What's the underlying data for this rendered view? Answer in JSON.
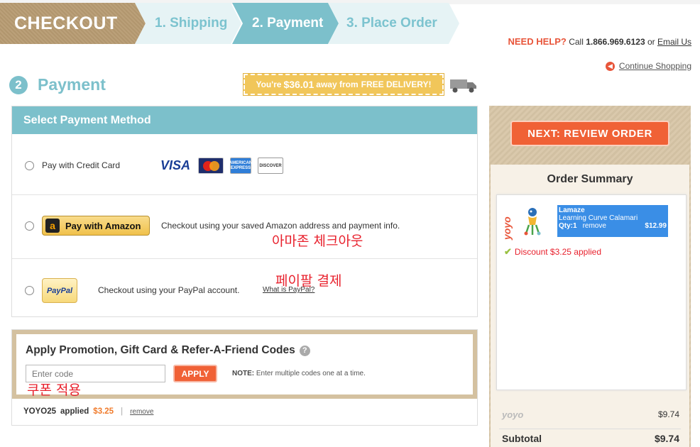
{
  "steps": {
    "checkout": "CHECKOUT",
    "shipping": "1. Shipping",
    "payment": "2. Payment",
    "place_order": "3. Place Order"
  },
  "help": {
    "need_help": "NEED HELP?",
    "call": "Call",
    "phone": "1.866.969.6123",
    "or": "or",
    "email": "Email Us"
  },
  "continue_shopping": "Continue Shopping",
  "payment": {
    "number": "2",
    "title": "Payment",
    "free_delivery": {
      "prefix": "You're",
      "amount": "$36.01",
      "middle": "away from",
      "suffix": "FREE DELIVERY!"
    }
  },
  "method": {
    "header": "Select Payment Method",
    "credit_card_label": "Pay with Credit Card",
    "cards": [
      "VISA",
      "MasterCard",
      "AMERICAN EXPRESS",
      "DISCOVER"
    ],
    "amazon_button": "Pay with Amazon",
    "amazon_desc": "Checkout using your saved Amazon address and payment info.",
    "amazon_annotation": "아마존 체크아웃",
    "paypal_button": "PayPal",
    "paypal_desc": "Checkout using your PayPal account.",
    "paypal_link": "What is PayPal?",
    "paypal_annotation": "페이팔 결제"
  },
  "promo": {
    "title": "Apply Promotion, Gift Card & Refer-A-Friend Codes",
    "placeholder": "Enter code",
    "apply": "APPLY",
    "note_label": "NOTE:",
    "note_text": "Enter multiple codes one at a time.",
    "annotation": "쿠폰 적용",
    "applied_code": "YOYO25",
    "applied_word": "applied",
    "applied_amount": "$3.25",
    "separator": "|",
    "remove": "remove"
  },
  "summary": {
    "next_button": "NEXT: REVIEW ORDER",
    "title": "Order Summary",
    "item": {
      "brand": "Lamaze",
      "name": "Learning Curve Calamari",
      "qty": "Qty:1",
      "remove": "remove",
      "price": "$12.99"
    },
    "discount": "Discount $3.25 applied",
    "store_logo": "yoyo",
    "store_total": "$9.74",
    "subtotal_label": "Subtotal",
    "subtotal_value": "$9.74"
  },
  "colors": {
    "accent_teal": "#7cc0cb",
    "accent_orange": "#f06136",
    "kraft": "#b79b72",
    "annotation_red": "#e8212d"
  }
}
